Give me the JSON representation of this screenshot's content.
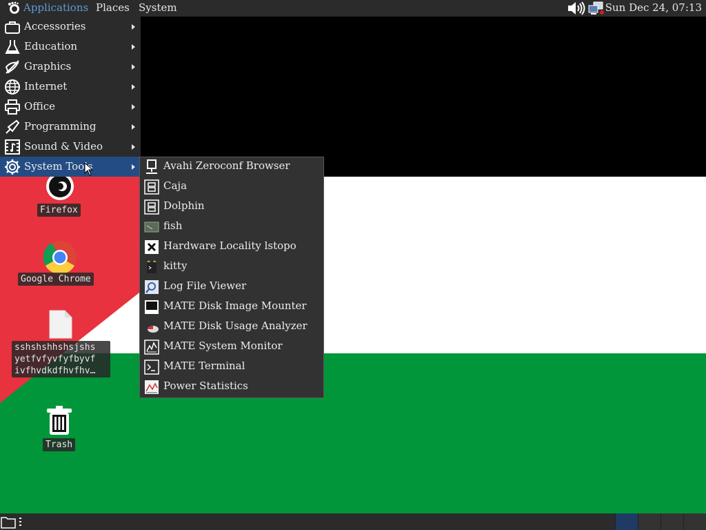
{
  "top_panel": {
    "applications": "Applications",
    "places": "Places",
    "system": "System",
    "clock": "Sun Dec 24, 07:13"
  },
  "apps_menu": {
    "items": [
      {
        "label": "Accessories",
        "icon": "accessories-icon"
      },
      {
        "label": "Education",
        "icon": "education-icon"
      },
      {
        "label": "Graphics",
        "icon": "graphics-icon"
      },
      {
        "label": "Internet",
        "icon": "internet-icon"
      },
      {
        "label": "Office",
        "icon": "office-icon"
      },
      {
        "label": "Programming",
        "icon": "programming-icon"
      },
      {
        "label": "Sound & Video",
        "icon": "sound-video-icon"
      },
      {
        "label": "System Tools",
        "icon": "system-tools-icon"
      }
    ],
    "active": "System Tools"
  },
  "submenu": {
    "items": [
      {
        "label": "Avahi Zeroconf Browser",
        "icon": "network-browser-icon"
      },
      {
        "label": "Caja",
        "icon": "file-manager-icon"
      },
      {
        "label": "Dolphin",
        "icon": "file-manager-icon"
      },
      {
        "label": "fish",
        "icon": "fish-terminal-icon"
      },
      {
        "label": "Hardware Locality lstopo",
        "icon": "hardware-icon"
      },
      {
        "label": "kitty",
        "icon": "kitty-icon"
      },
      {
        "label": "Log File Viewer",
        "icon": "log-viewer-icon"
      },
      {
        "label": "MATE Disk Image Mounter",
        "icon": "disk-mounter-icon"
      },
      {
        "label": "MATE Disk Usage Analyzer",
        "icon": "disk-usage-icon"
      },
      {
        "label": "MATE System Monitor",
        "icon": "system-monitor-icon"
      },
      {
        "label": "MATE Terminal",
        "icon": "terminal-icon"
      },
      {
        "label": "Power Statistics",
        "icon": "power-statistics-icon"
      }
    ]
  },
  "desktop": {
    "firefox": "Firefox",
    "chrome": "Google Chrome",
    "file": "sshshshhshsjshs\nyetfvfyvfyfbyvf\nivfhvdkdfhvfhv…",
    "trash": "Trash"
  },
  "colors": {
    "panel": "#2b2b2b",
    "highlight": "#244c84",
    "flag_black": "#000000",
    "flag_white": "#ffffff",
    "flag_green": "#009639",
    "flag_red": "#e8323f"
  }
}
